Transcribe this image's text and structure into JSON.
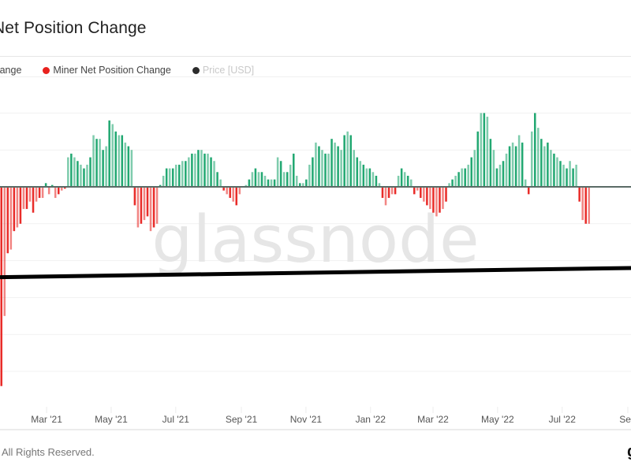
{
  "header": {
    "title": "Miner Net Position Change",
    "title_visible": "r Net Position Change"
  },
  "legend": {
    "items": [
      {
        "label": "tion Change",
        "color": "#16a36a"
      },
      {
        "label": "Miner Net Position Change",
        "color": "#e8211d"
      },
      {
        "label": "Price [USD]",
        "color": "#2b2b2b"
      }
    ]
  },
  "watermark": "glassnode",
  "footer": {
    "copyright": "All Rights Reserved.",
    "right_glyph": "g"
  },
  "colors": {
    "positive": "#16a36a",
    "negative": "#e8211d",
    "price": "#000000",
    "zero_line": "#5a6b66",
    "grid": "#f1f1f1",
    "watermark": "#e6e6e6"
  },
  "chart_data": {
    "type": "bar",
    "title": "Miner Net Position Change",
    "xlabel": "",
    "ylabel": "",
    "x_start": "2021-01-16",
    "x_end": "2022-09-04",
    "step_days": 3,
    "x_ticks": [
      "Mar '21",
      "May '21",
      "Jul '21",
      "Sep '21",
      "Nov '21",
      "Jan '22",
      "Mar '22",
      "May '22",
      "Jul '22",
      "Sep"
    ],
    "x_tick_dates": [
      "2021-03-01",
      "2021-05-01",
      "2021-07-01",
      "2021-09-01",
      "2021-11-01",
      "2022-01-01",
      "2022-03-01",
      "2022-05-01",
      "2022-07-01",
      "2022-09-01"
    ],
    "y_units": "grid intervals (axis labels not visible)",
    "ylim": [
      -5.8,
      2.1
    ],
    "grid": true,
    "legend_position": "top-left",
    "series": [
      {
        "name": "Miner Net Position Change",
        "type": "bar",
        "values": [
          -5.4,
          -3.5,
          -1.8,
          -1.7,
          -1.2,
          -1.1,
          -1.0,
          -0.6,
          -0.6,
          -0.4,
          -0.7,
          -0.4,
          -0.3,
          -0.3,
          0.1,
          -0.2,
          0.05,
          -0.3,
          -0.2,
          -0.1,
          -0.05,
          0.8,
          0.9,
          0.8,
          0.7,
          0.6,
          0.5,
          0.6,
          0.8,
          1.4,
          1.3,
          1.3,
          1.0,
          1.1,
          1.8,
          1.7,
          1.5,
          1.4,
          1.4,
          1.2,
          1.1,
          1.0,
          -0.5,
          -1.1,
          -1.0,
          -0.9,
          -0.8,
          -1.2,
          -1.1,
          -1.0,
          0.05,
          0.3,
          0.5,
          0.5,
          0.5,
          0.6,
          0.6,
          0.7,
          0.7,
          0.8,
          0.9,
          0.9,
          1.0,
          1.0,
          0.9,
          0.9,
          0.8,
          0.7,
          0.4,
          0.2,
          -0.1,
          -0.2,
          -0.3,
          -0.4,
          -0.5,
          -0.2,
          0.0,
          0.05,
          0.2,
          0.4,
          0.5,
          0.4,
          0.4,
          0.3,
          0.2,
          0.2,
          0.2,
          0.8,
          0.7,
          0.4,
          0.4,
          0.6,
          0.9,
          0.3,
          0.1,
          0.1,
          0.2,
          0.6,
          0.8,
          1.2,
          1.1,
          1.0,
          0.9,
          0.9,
          1.3,
          1.2,
          1.1,
          1.0,
          1.4,
          1.5,
          1.4,
          1.0,
          0.8,
          0.7,
          0.6,
          0.5,
          0.5,
          0.4,
          0.3,
          0.1,
          -0.3,
          -0.5,
          -0.3,
          -0.2,
          -0.2,
          0.3,
          0.5,
          0.4,
          0.3,
          0.2,
          -0.2,
          -0.1,
          -0.3,
          -0.4,
          -0.5,
          -0.6,
          -0.7,
          -0.8,
          -0.7,
          -0.6,
          -0.4,
          0.1,
          0.2,
          0.3,
          0.4,
          0.5,
          0.5,
          0.6,
          0.8,
          1.0,
          1.5,
          2.0,
          2.0,
          1.9,
          1.3,
          1.0,
          0.5,
          0.6,
          0.7,
          0.9,
          1.1,
          1.2,
          1.1,
          1.4,
          1.2,
          0.2,
          -0.2,
          1.5,
          2.0,
          1.6,
          1.3,
          1.1,
          1.2,
          1.0,
          0.9,
          0.8,
          0.7,
          0.6,
          0.5,
          0.7,
          0.5,
          0.6,
          -0.4,
          -0.9,
          -1.0,
          -1.0
        ]
      },
      {
        "name": "Price [USD]",
        "type": "line",
        "values_relative": [
          -2.45,
          -2.2
        ],
        "note": "nearly flat black line, slightly rising; price axis labels not visible"
      }
    ]
  }
}
